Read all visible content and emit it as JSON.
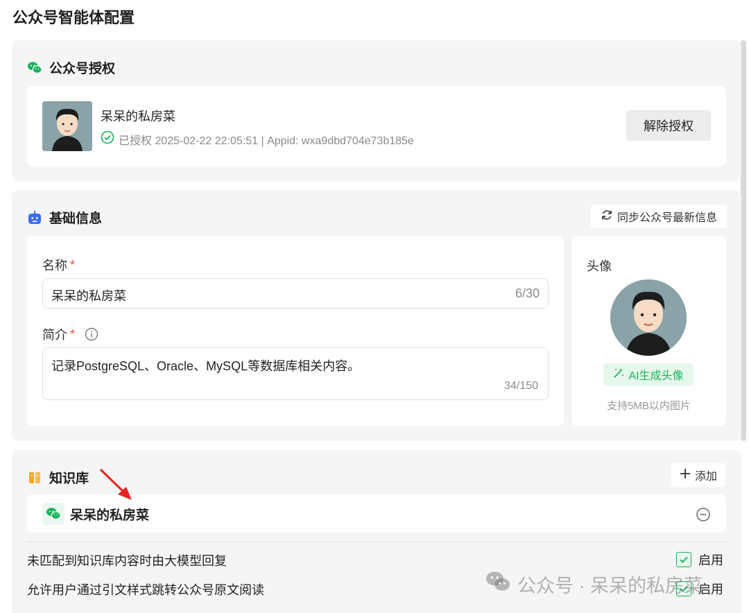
{
  "page": {
    "title": "公众号智能体配置"
  },
  "auth": {
    "section_title": "公众号授权",
    "account_name": "呆呆的私房菜",
    "status_text": "已授权 2025-02-22 22:05:51 | Appid: wxa9dbd704e73b185e",
    "revoke_label": "解除授权"
  },
  "basic": {
    "section_title": "基础信息",
    "sync_label": "同步公众号最新信息",
    "name_label": "名称",
    "name_value": "呆呆的私房菜",
    "name_count": "6/30",
    "desc_label": "简介",
    "desc_value": "记录PostgreSQL、Oracle、MySQL等数据库相关内容。",
    "desc_count": "34/150",
    "required_mark": "*",
    "avatar_label": "头像",
    "ai_avatar_label": "AI生成头像",
    "avatar_hint": "支持5MB以内图片"
  },
  "kb": {
    "section_title": "知识库",
    "add_label": "添加",
    "items": [
      {
        "name": "呆呆的私房菜"
      }
    ],
    "options": [
      {
        "text": "未匹配到知识库内容时由大模型回复",
        "state": "启用",
        "checked": true
      },
      {
        "text": "允许用户通过引文样式跳转公众号原文阅读",
        "state": "启用",
        "checked": true
      }
    ]
  },
  "watermark": {
    "text": "公众号 · 呆呆的私房菜"
  },
  "colors": {
    "accent_green": "#17b35a",
    "required_red": "#e54d42",
    "annotation_arrow": "#e8231f"
  },
  "icons": [
    "wechat-icon",
    "robot-icon",
    "refresh-icon",
    "info-icon",
    "magic-wand-icon",
    "book-icon",
    "plus-icon",
    "minus-circle-icon",
    "check-circle-icon",
    "checkbox-icon"
  ]
}
